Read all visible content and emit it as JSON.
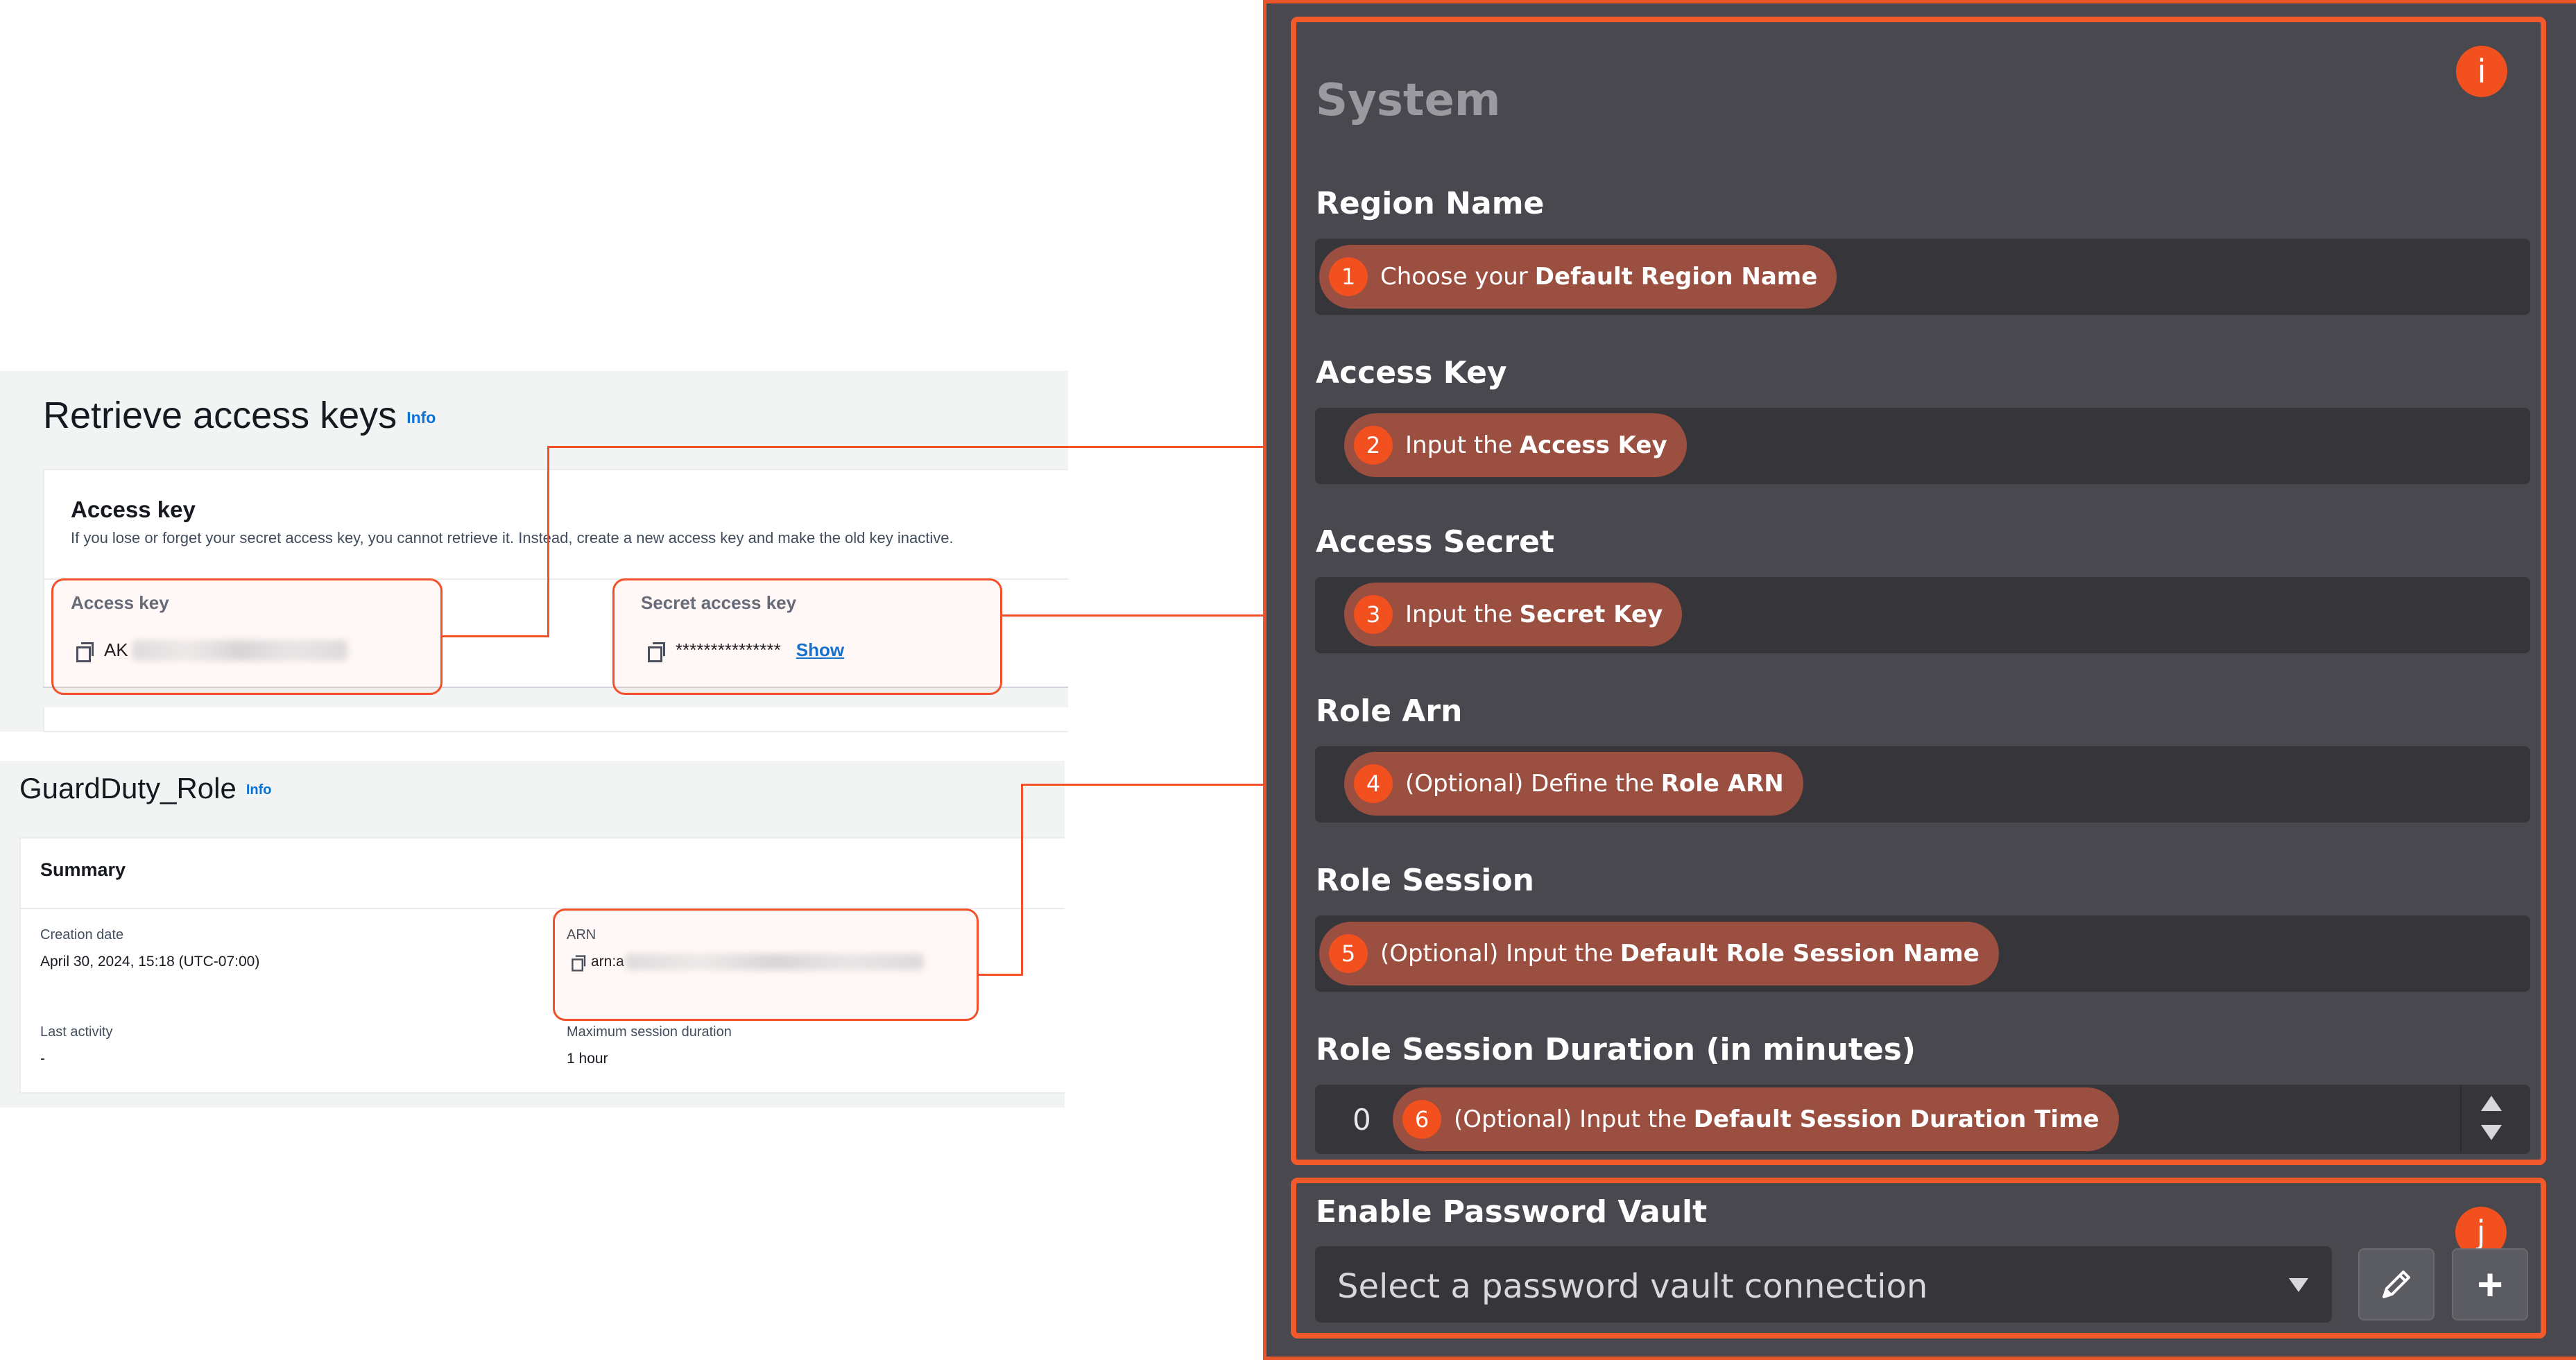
{
  "aws_access_keys": {
    "title": "Retrieve access keys",
    "info_link": "Info",
    "card_heading": "Access key",
    "description": "If you lose or forget your secret access key, you cannot retrieve it. Instead, create a new access key and make the old key inactive.",
    "access_key_label": "Access key",
    "access_key_value_prefix": "AK",
    "secret_key_label": "Secret access key",
    "secret_key_value": "***************",
    "show_link": "Show"
  },
  "aws_role": {
    "title": "GuardDuty_Role",
    "info_link": "Info",
    "summary_heading": "Summary",
    "creation_date_label": "Creation date",
    "creation_date_value": "April 30, 2024, 15:18 (UTC-07:00)",
    "arn_label": "ARN",
    "arn_value_prefix": "arn:a",
    "last_activity_label": "Last activity",
    "last_activity_value": "-",
    "max_session_label": "Maximum session duration",
    "max_session_value": "1 hour"
  },
  "system": {
    "title": "System",
    "corner_badge": "i",
    "fields": [
      {
        "label": "Region Name",
        "step": "1",
        "hint_plain": "Choose your",
        "hint_bold": "Default Region Name"
      },
      {
        "label": "Access Key",
        "step": "2",
        "hint_plain": "Input the",
        "hint_bold": "Access Key"
      },
      {
        "label": "Access Secret",
        "step": "3",
        "hint_plain": "Input the",
        "hint_bold": "Secret Key"
      },
      {
        "label": "Role Arn",
        "step": "4",
        "hint_plain": "(Optional) Define the",
        "hint_bold": "Role ARN"
      },
      {
        "label": "Role Session",
        "step": "5",
        "hint_plain": "(Optional) Input the",
        "hint_bold": "Default Role Session Name"
      },
      {
        "label": "Role Session Duration (in minutes)",
        "step": "6",
        "hint_plain": "(Optional) Input the",
        "hint_bold": "Default Session Duration Time",
        "value": "0"
      }
    ]
  },
  "vault": {
    "title": "Enable Password Vault",
    "corner_badge": "j",
    "select_placeholder": "Select a password vault connection",
    "edit_icon": "pencil-icon",
    "add_icon": "plus-icon",
    "add_label": "+"
  },
  "colors": {
    "accent": "#f25a2b",
    "panel_bg": "#48484e",
    "input_bg": "#35353a",
    "pill_bg": "#9a4f40",
    "aws_link": "#0972d3"
  }
}
